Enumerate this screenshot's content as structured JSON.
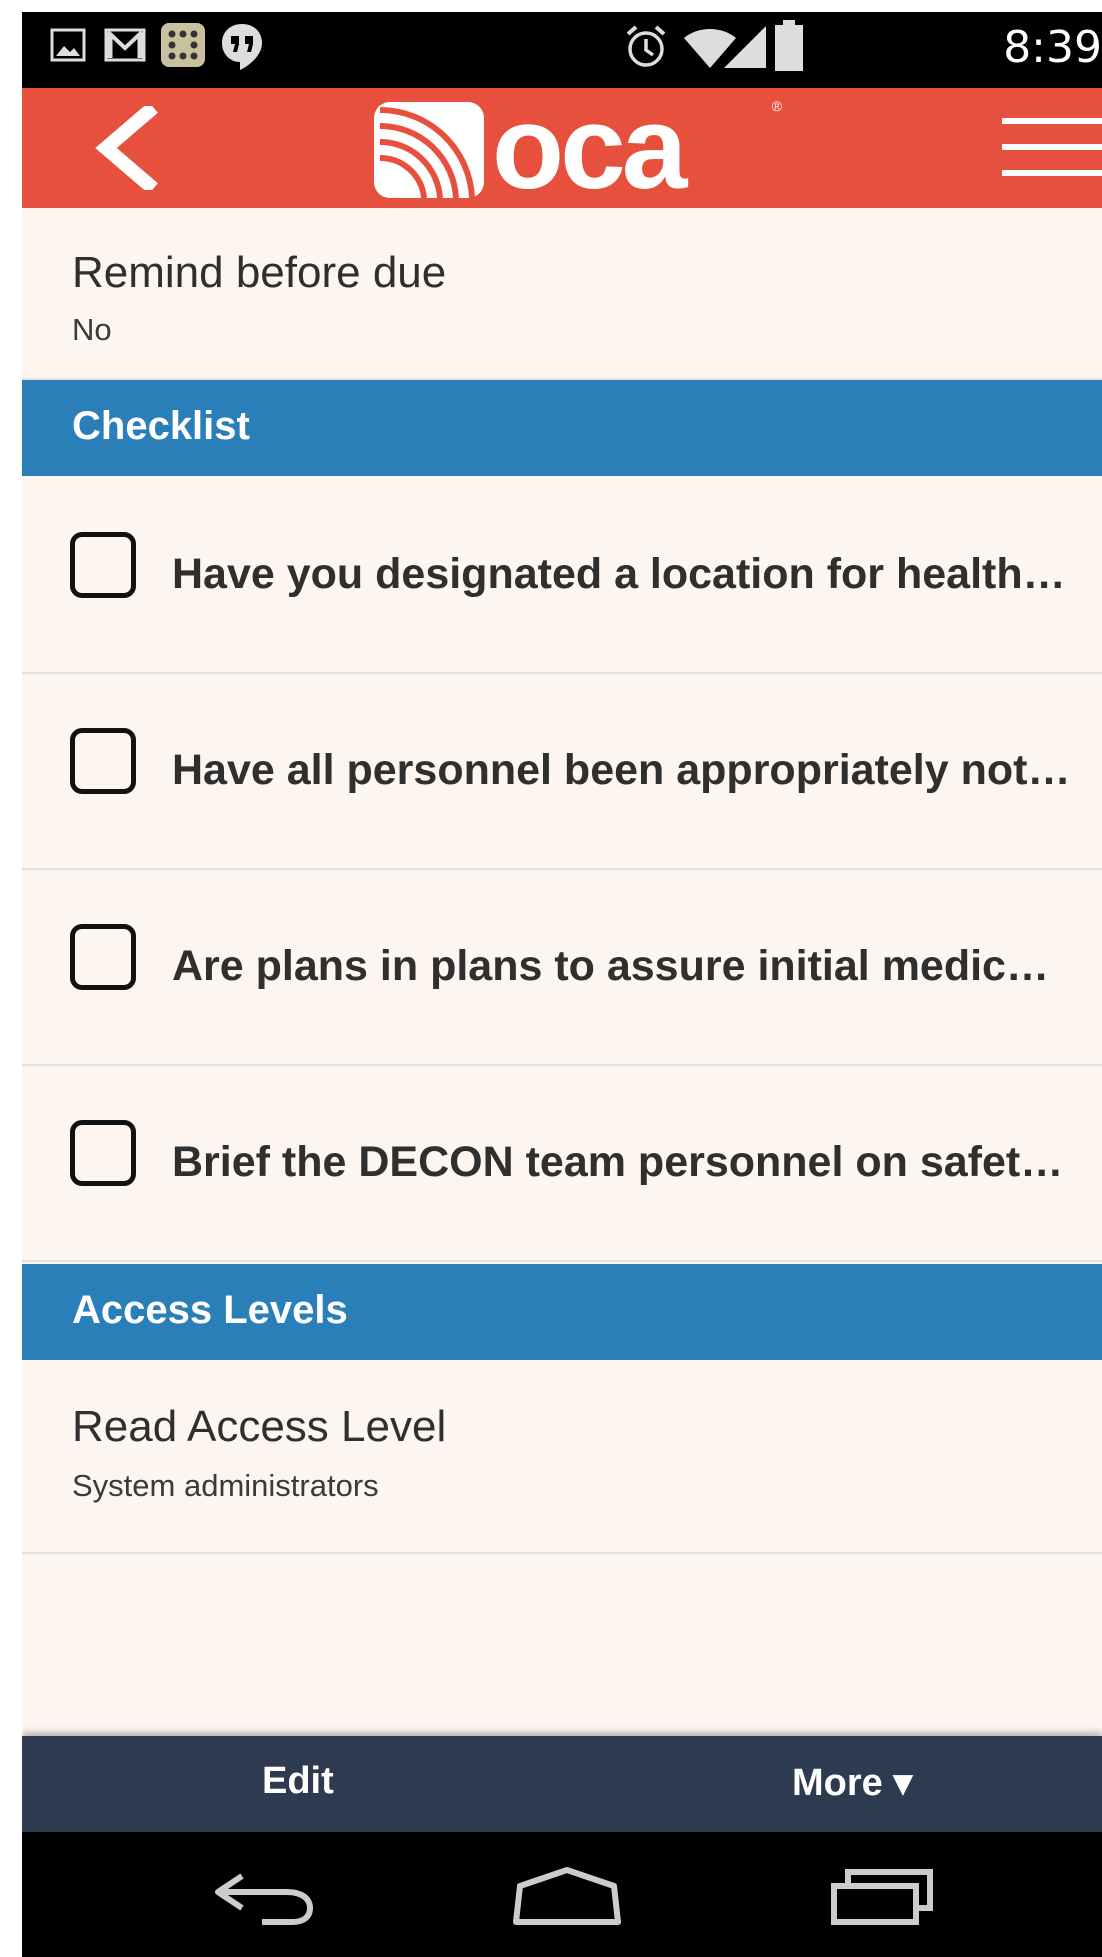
{
  "status_bar": {
    "time": "8:39",
    "left_icons": [
      "image-icon",
      "gmail-icon",
      "dice-game-icon",
      "hangouts-icon"
    ],
    "right_icons": [
      "alarm-icon",
      "wifi-icon",
      "signal-icon",
      "battery-icon"
    ]
  },
  "app_bar": {
    "logo_text": "oca",
    "logo_mark": "®",
    "background": "#e8503e"
  },
  "fields": {
    "remind": {
      "label": "Remind before due",
      "value": "No"
    },
    "read_access": {
      "label": "Read Access Level",
      "value": "System administrators"
    }
  },
  "sections": {
    "checklist": "Checklist",
    "access_levels": "Access Levels",
    "header_color": "#2a7fb9"
  },
  "checklist_items": [
    {
      "text": "Have you designated a location for health and safety monitoring",
      "checked": false
    },
    {
      "text": "Have all personnel been appropriately notified",
      "checked": false
    },
    {
      "text": "Are plans in plans to assure initial medical screening",
      "checked": false
    },
    {
      "text": "Brief the DECON team personnel on safety procedures",
      "checked": false
    }
  ],
  "action_bar": {
    "edit_label": "Edit",
    "more_label": "More ▾",
    "background": "#2d3a4f"
  },
  "nav_bar": {
    "icons": [
      "back-nav-icon",
      "home-nav-icon",
      "recents-nav-icon"
    ]
  }
}
